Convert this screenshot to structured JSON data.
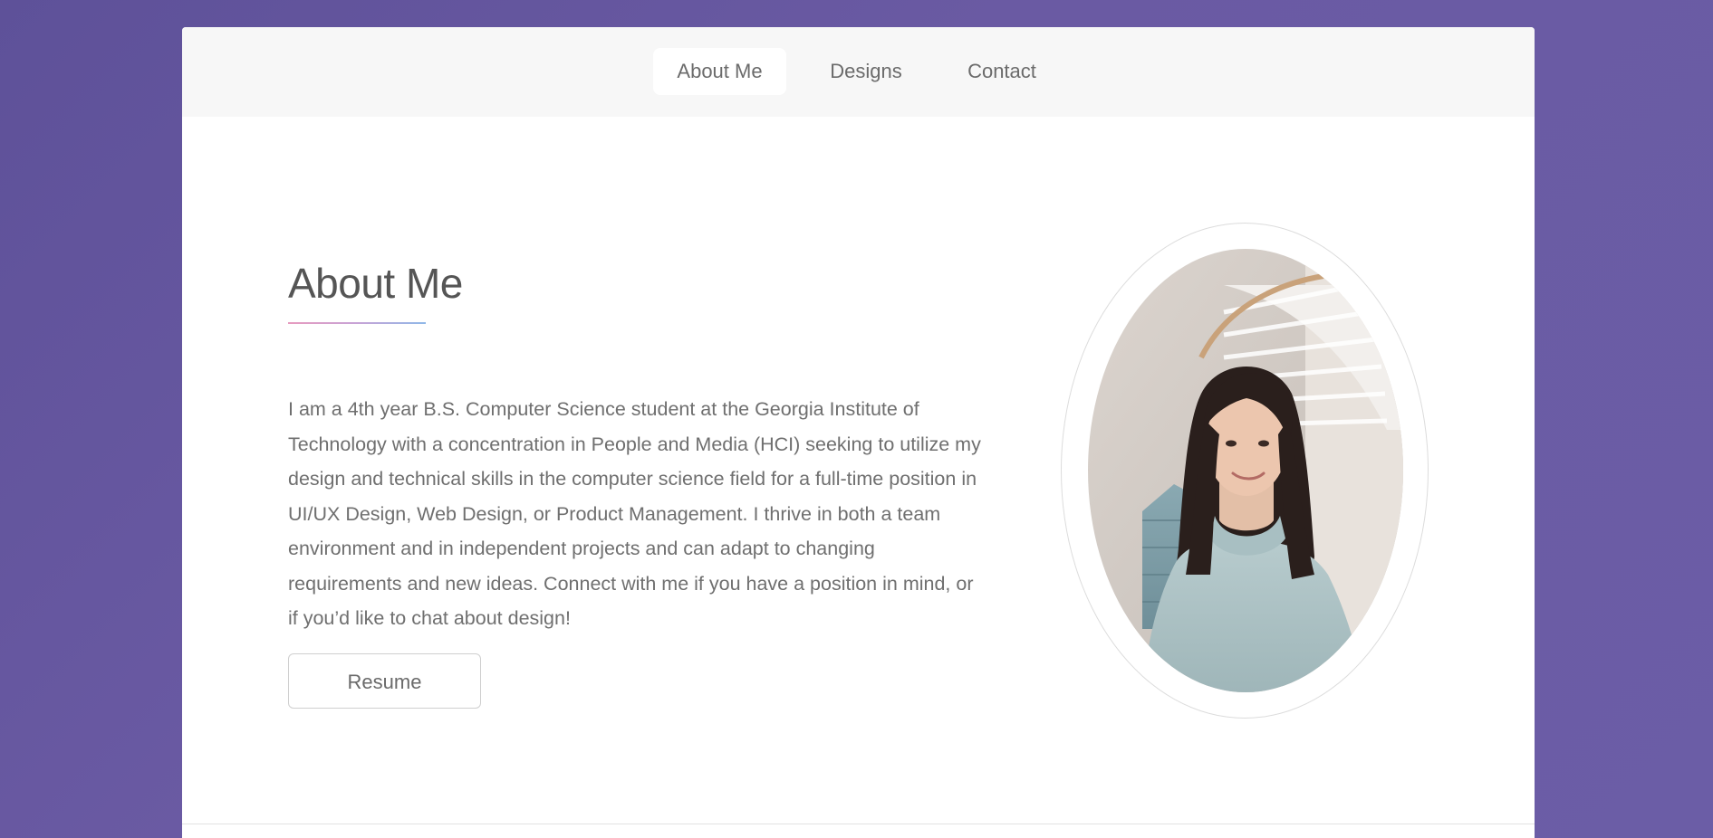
{
  "nav": {
    "items": [
      {
        "label": "About Me",
        "active": true
      },
      {
        "label": "Designs",
        "active": false
      },
      {
        "label": "Contact",
        "active": false
      }
    ]
  },
  "about": {
    "title": "About Me",
    "bio": "I am a 4th year B.S. Computer Science student at the Georgia Institute of Technology with a concentration in People and Media (HCI) seeking to utilize my design and technical skills in the computer science field for a full-time position in UI/UX Design, Web Design, or Product Management. I thrive in both a team environment and in independent projects and can adapt to changing requirements and new ideas. Connect with me if you have a position in mind, or if you’d like to chat about design!",
    "resume_label": "Resume"
  },
  "colors": {
    "background": "#5e5199",
    "nav_bg": "#f7f7f7",
    "divider_start": "#e79bbf",
    "divider_end": "#8fb8e8"
  }
}
